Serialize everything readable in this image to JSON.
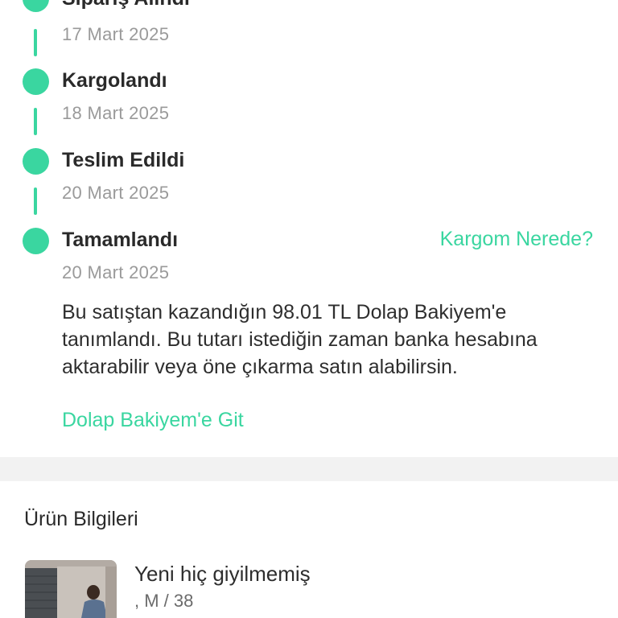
{
  "timeline": {
    "steps": [
      {
        "title": "Sipariş Alındı",
        "date": "17 Mart 2025"
      },
      {
        "title": "Kargolandı",
        "date": "18 Mart 2025"
      },
      {
        "title": "Teslim Edildi",
        "date": "20 Mart 2025"
      },
      {
        "title": "Tamamlandı",
        "date": "20 Mart 2025"
      }
    ],
    "track_link_label": "Kargom Nerede?",
    "info_text": "Bu satıştan kazandığın 98.01 TL Dolap Bakiyem'e tanımlandı. Bu tutarı istediğin zaman banka hesabına aktarabilir veya öne çıkarma satın alabilirsin.",
    "balance_link_label": "Dolap Bakiyem'e Git"
  },
  "product_section": {
    "title": "Ürün Bilgileri",
    "product": {
      "name": "Yeni hiç giyilmemiş",
      "meta": ", M / 38"
    }
  },
  "colors": {
    "accent": "#3ad6a0",
    "muted_text": "#9a9a9a",
    "divider": "#f2f2f2"
  },
  "icons": {
    "timeline_dot": "status-dot-icon"
  }
}
